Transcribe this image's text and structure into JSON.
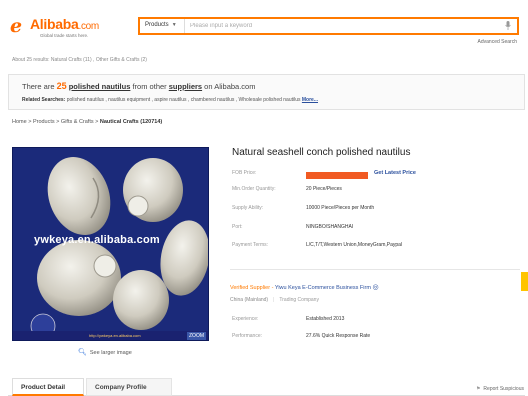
{
  "header": {
    "logo_mark": "e",
    "logo_text": "Alibaba",
    "logo_com": ".com",
    "logo_tagline": "Global trade starts here.",
    "search_category": "Products",
    "search_placeholder": "Please input a keyword",
    "advanced_search": "Advanced Search"
  },
  "about_results": "About 25 results: Natural Crafts (11) , Other Gifts & Crafts (2)",
  "banner": {
    "prefix": "There are ",
    "count": "25",
    "mid1": " ",
    "product_link": "polished nautilus",
    "mid2": " from other ",
    "suppliers_link": "suppliers",
    "suffix": " on Alibaba.com",
    "related_label": "Related Searches:",
    "related_terms": " polished nautilus , nautilus equipment , aspire nautilus , chambered nautilus , Wholesale polished nautilus ",
    "more": "More..."
  },
  "breadcrumb": {
    "path": "Home > Products > Gifts & Crafts > ",
    "current": "Nautical Crafts (120714)"
  },
  "product_image": {
    "watermark": "ywkeya.en.alibaba.com",
    "url_caption": "http://ywkeya.en.alibaba.com",
    "zoom": "ZOOM",
    "view_larger": "See larger image"
  },
  "product": {
    "title": "Natural seashell conch polished nautilus",
    "fields": [
      {
        "label": "FOB Price:",
        "value": ""
      },
      {
        "label": "Min.Order Quantity:",
        "value": "20 Piece/Pieces"
      },
      {
        "label": "Supply Ability:",
        "value": "10000 Piece/Pieces per Month"
      },
      {
        "label": "Port:",
        "value": "NINGBO/SHANGHAI"
      },
      {
        "label": "Payment Terms:",
        "value": "L/C,T/T,Western Union,MoneyGram,Paypal"
      }
    ],
    "get_price": "Get Latest Price"
  },
  "supplier": {
    "verified_label": "Verified Supplier",
    "dash": " - ",
    "firm": "Yiwu Keya E-Commerce Business Firm",
    "region": "China (Mainland)",
    "type": "Trading Company",
    "fields": [
      {
        "label": "Experience:",
        "value": "Established 2013"
      },
      {
        "label": "Performance:",
        "value": "27.6% Quick Response Rate"
      }
    ]
  },
  "tabs": [
    {
      "label": "Product Detail"
    },
    {
      "label": "Company Profile"
    }
  ],
  "report": "Report Suspicious",
  "colors": {
    "brand": "#ff6a00",
    "link": "#2a4f9d",
    "price_mask": "#f15a22",
    "photo_bg": "#1b2a7a"
  }
}
